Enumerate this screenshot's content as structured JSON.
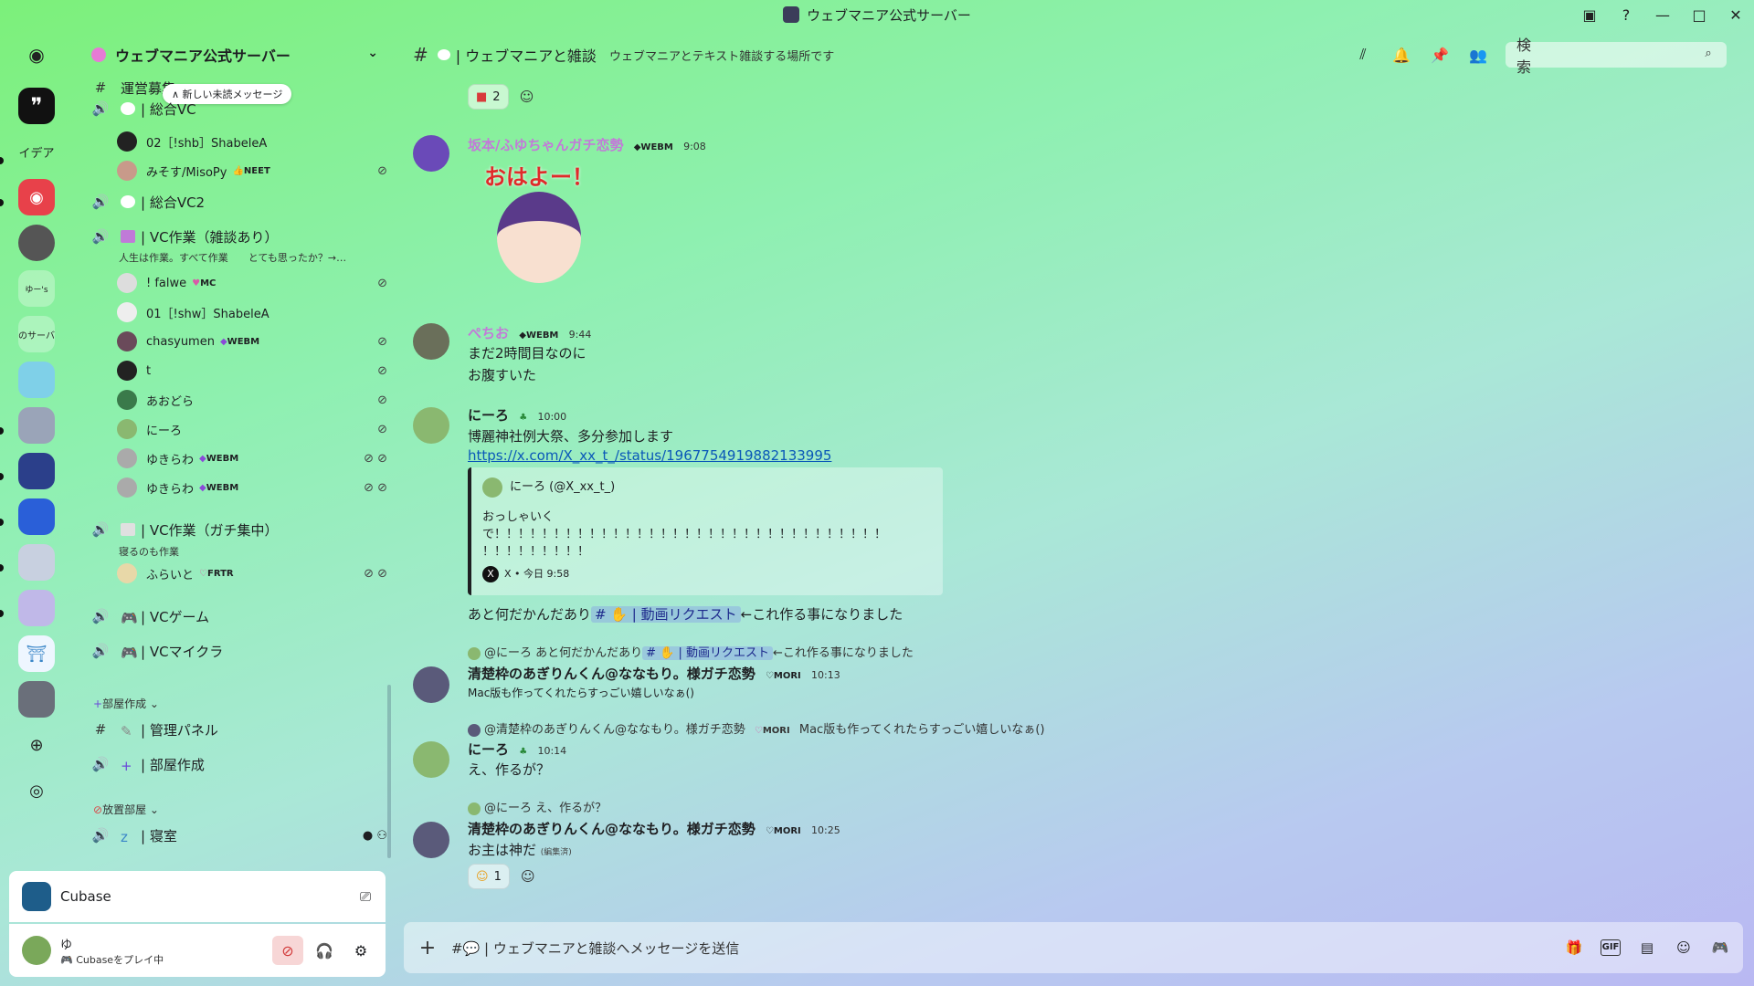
{
  "window": {
    "title": "ウェブマニア公式サーバー"
  },
  "titlebar_controls": [
    "inbox-icon",
    "help-icon",
    "minimize",
    "maximize",
    "close"
  ],
  "server": {
    "name": "ウェブマニア公式サーバー",
    "new_unread": "∧ 新しい未読メッセージ"
  },
  "rail_labels": {
    "idea": "イデア",
    "yuu": "ゆー's",
    "oursrv": "のサーバ"
  },
  "channels": {
    "truncated_top": "運営募集",
    "vc1": "| 総合VC",
    "vc2": "| 総合VC2",
    "work": "| VC作業（雑談あり）",
    "work_status": "人生は作業。すべて作業　　とても思ったか？→…",
    "focus": "| VC作業（ガチ集中）",
    "focus_status": "寝るのも作業",
    "game": "| VCゲーム",
    "mc": "| VCマイクラ",
    "cat_create": "部屋作成",
    "admin": "| 管理パネル",
    "create": "| 部屋作成",
    "cat_afk": "放置部屋",
    "sleep": "| 寝室"
  },
  "vc1_users": [
    {
      "name": "02［!shb］ShabeleA",
      "tag": ""
    },
    {
      "name": "みそす/MisoPy",
      "tag": "NEET"
    }
  ],
  "work_users": [
    {
      "name": "! falwe",
      "tag": "MC"
    },
    {
      "name": "01［!shw］ShabeleA",
      "tag": ""
    },
    {
      "name": "chasyumen",
      "tag": "WEBM"
    },
    {
      "name": "t",
      "tag": ""
    },
    {
      "name": "あおどら",
      "tag": ""
    },
    {
      "name": "にーろ",
      "tag": ""
    },
    {
      "name": "ゆきらわ",
      "tag": "WEBM"
    },
    {
      "name": "ゆきらわ",
      "tag": "WEBM"
    }
  ],
  "focus_users": [
    {
      "name": "ふらいと",
      "tag": "FRTR"
    }
  ],
  "activity": {
    "app": "Cubase"
  },
  "me": {
    "name": "ゆ",
    "status": "Cubaseをプレイ中"
  },
  "channel_header": {
    "name": "| ウェブマニアと雑談",
    "topic": "ウェブマニアとテキスト雑談する場所です",
    "search_placeholder": "検索"
  },
  "messages": {
    "top_reaction_count": "2",
    "m1_author": "坂本/ふゆちゃんガチ恋勢",
    "m1_tag": "WEBM",
    "m1_time": "9:08",
    "m1_sticker": "おはよー！",
    "m2_author": "ぺちお",
    "m2_tag": "WEBM",
    "m2_time": "9:44",
    "m2_line1": "まだ2時間目なのに",
    "m2_line2": "お腹すいた",
    "m3_author": "にーろ",
    "m3_time": "10:00",
    "m3_line1": "博麗神社例大祭、多分参加します",
    "m3_link": "https://x.com/X_xx_t_/status/1967754919882133995",
    "embed_author": "にーろ (@X_xx_t_)",
    "embed_l1": "おっしゃいく",
    "embed_l2": "で！！！！！！！！！！！！！！！！！！！！！！！！！！！！！！！！！",
    "embed_l3": "！！！！！！！！！",
    "embed_footer": "X • 今日 9:58",
    "m3_line2_pre": "あと何だかんだあり",
    "m3_channel": "# ✋ | 動画リクエスト",
    "m3_line2_post": "←これ作る事になりました",
    "r4_reply": "@にーろ あと何だかんだあり",
    "r4_reply_channel": "# ✋ | 動画リクエスト",
    "r4_reply_post": "←これ作る事になりました",
    "m4_author": "清楚枠のあぎりんくん@ななもり。様ガチ恋勢",
    "m4_tag": "MORI",
    "m4_time": "10:13",
    "m4_text": "Mac版も作ってくれたらすっごい嬉しいなぁ()",
    "r5_reply": "@清楚枠のあぎりんくん@ななもり。様ガチ恋勢",
    "r5_tag": "MORI",
    "r5_post": "Mac版も作ってくれたらすっごい嬉しいなぁ()",
    "m5_author": "にーろ",
    "m5_time": "10:14",
    "m5_text": "え、作るが？",
    "r6_reply": "@にーろ え、作るが？",
    "m6_author": "清楚枠のあぎりんくん@ななもり。様ガチ恋勢",
    "m6_tag": "MORI",
    "m6_time": "10:25",
    "m6_text": "お主は神だ",
    "m6_edited": "(編集済)",
    "bottom_reaction_count": "1"
  },
  "composer": {
    "placeholder": "#💬 | ウェブマニアと雑談へメッセージを送信",
    "gif": "GIF"
  },
  "colors": {
    "accent_green": "#7cf07a",
    "lavender": "#b9b8f2",
    "link": "#0a58b8",
    "tag_pink": "#d85aa8"
  }
}
